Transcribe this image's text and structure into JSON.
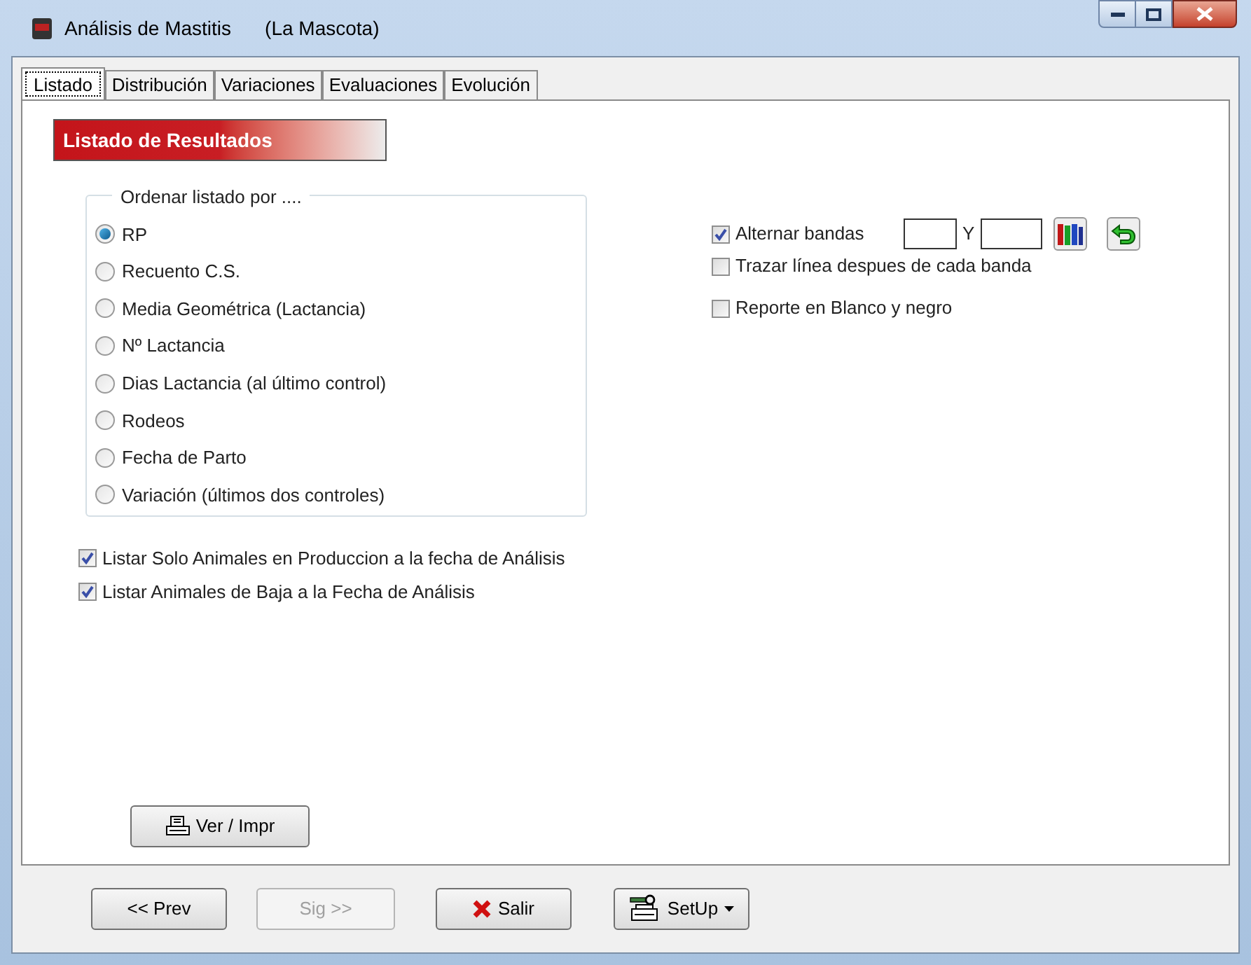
{
  "window": {
    "title": "Análisis de Mastitis",
    "subtitle": "(La Mascota)"
  },
  "tabs": [
    {
      "label": "Listado",
      "selected": true
    },
    {
      "label": "Distribución",
      "selected": false
    },
    {
      "label": "Variaciones",
      "selected": false
    },
    {
      "label": "Evaluaciones",
      "selected": false
    },
    {
      "label": "Evolución",
      "selected": false
    }
  ],
  "section_header": "Listado de Resultados",
  "sort_group": {
    "title": "Ordenar listado por ....",
    "options": [
      {
        "label": "RP",
        "selected": true
      },
      {
        "label": "Recuento C.S.",
        "selected": false
      },
      {
        "label": "Media Geométrica (Lactancia)",
        "selected": false
      },
      {
        "label": "Nº Lactancia",
        "selected": false
      },
      {
        "label": "Dias Lactancia (al último control)",
        "selected": false
      },
      {
        "label": "Rodeos",
        "selected": false
      },
      {
        "label": "Fecha de Parto",
        "selected": false
      },
      {
        "label": "Variación (últimos dos controles)",
        "selected": false
      }
    ]
  },
  "filters": [
    {
      "label": "Listar Solo Animales en Produccion a la fecha de Análisis",
      "checked": true
    },
    {
      "label": "Listar Animales de Baja a la Fecha de Análisis",
      "checked": true
    }
  ],
  "band_options": [
    {
      "label": "Alternar bandas",
      "checked": true,
      "separator": "Y"
    },
    {
      "label": "Trazar línea despues de cada banda",
      "checked": false
    },
    {
      "label": "Reporte en Blanco y negro",
      "checked": false
    }
  ],
  "view_button": "Ver / Impr",
  "footer_buttons": [
    {
      "label": "<< Prev",
      "disabled": false,
      "kind": "plain"
    },
    {
      "label": "Sig >>",
      "disabled": true,
      "kind": "plain"
    },
    {
      "label": "Salir",
      "disabled": false,
      "kind": "exit"
    },
    {
      "label": "SetUp",
      "disabled": false,
      "kind": "menu"
    }
  ]
}
